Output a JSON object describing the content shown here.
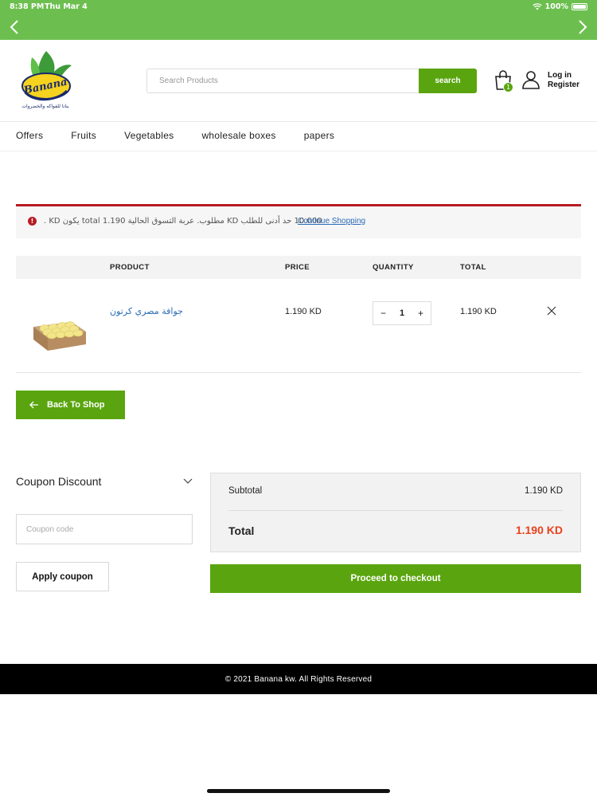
{
  "status_bar": {
    "time": "8:38 PM",
    "date": "Thu Mar 4",
    "battery": "100%"
  },
  "header": {
    "logo_text": "Banana",
    "search_placeholder": "Search Products",
    "search_button": "search",
    "cart_count": "1",
    "login": "Log in",
    "register": "Register"
  },
  "menu": [
    "Offers",
    "Fruits",
    "Vegetables",
    "wholesale boxes",
    "papers"
  ],
  "notice": {
    "icon": "!",
    "text": "10.000 حد أدنى للطلب KD مطلوب. عربة التسوق الحالية total 1.190 يكون KD .",
    "link": "Continue Shopping"
  },
  "cart": {
    "headers": {
      "product": "PRODUCT",
      "price": "PRICE",
      "quantity": "QUANTITY",
      "total": "TOTAL"
    },
    "item": {
      "name": "جوافة مصري كرتون",
      "price": "1.190 KD",
      "qty": "1",
      "minus": "−",
      "plus": "+",
      "total": "1.190 KD"
    }
  },
  "back_button": "Back To Shop",
  "coupon": {
    "title": "Coupon Discount",
    "placeholder": "Coupon code",
    "apply": "Apply coupon"
  },
  "totals": {
    "subtotal_label": "Subtotal",
    "subtotal_value": "1.190 KD",
    "total_label": "Total",
    "total_value": "1.190 KD"
  },
  "checkout_button": "Proceed to checkout",
  "footer": "© 2021 Banana kw. All Rights Reserved",
  "colors": {
    "brand_green": "#5aa50f",
    "topbar_green": "#6cbf4f",
    "error_red": "#b81c23",
    "total_orange": "#e8421c",
    "link_blue": "#2b6bb5"
  }
}
